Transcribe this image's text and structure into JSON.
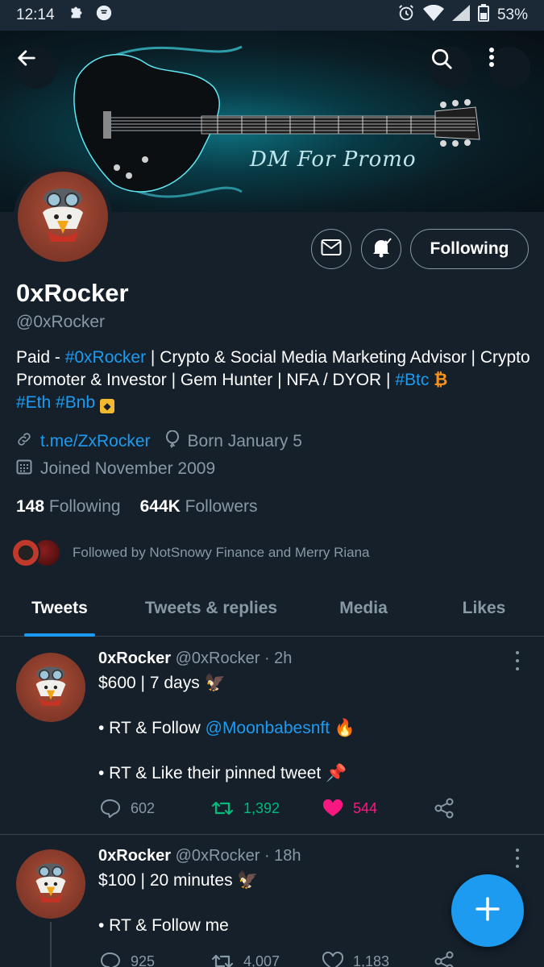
{
  "status_bar": {
    "time": "12:14",
    "battery": "53%",
    "icons": [
      "puzzle-icon",
      "chat-bubble-icon",
      "alarm-icon",
      "wifi-icon",
      "signal-icon",
      "battery-icon"
    ]
  },
  "header": {
    "banner_text": "DM For Promo",
    "back_icon": "arrow-left-icon",
    "search_icon": "search-icon",
    "more_icon": "more-vertical-icon"
  },
  "profile": {
    "name": "0xRocker",
    "handle": "@0xRocker",
    "bio": {
      "prefix": "Paid - ",
      "tag1": "#0xRocker",
      "text1": " | Crypto & Social Media Marketing Advisor | Crypto Promoter & Investor | Gem Hunter | NFA / DYOR | ",
      "tag2": "#Btc",
      "emoji1": "₿",
      "tag3": "#Eth",
      "tag4": "#Bnb",
      "emoji2": "◆"
    },
    "website": "t.me/ZxRocker",
    "birthday": "Born January 5",
    "joined": "Joined November 2009",
    "following_count": "148",
    "following_label": "Following",
    "followers_count": "644K",
    "followers_label": "Followers",
    "followed_by": "Followed by NotSnowy Finance and Merry Riana",
    "following_button": "Following"
  },
  "tabs": [
    {
      "label": "Tweets",
      "active": true
    },
    {
      "label": "Tweets & replies",
      "active": false
    },
    {
      "label": "Media",
      "active": false
    },
    {
      "label": "Likes",
      "active": false
    }
  ],
  "tweets": [
    {
      "name": "0xRocker",
      "handle": "@0xRocker",
      "time": "· 2h",
      "line1": "$600 | 7 days 🦅",
      "line2_prefix": "• RT & Follow ",
      "line2_mention": "@Moonbabesnft",
      "line2_suffix": " 🔥",
      "line3": "• RT & Like their pinned tweet 📌",
      "replies": "602",
      "retweets": "1,392",
      "likes": "544",
      "retweeted": true,
      "liked": true
    },
    {
      "name": "0xRocker",
      "handle": "@0xRocker",
      "time": "· 18h",
      "line1": "$100 | 20 minutes 🦅",
      "line2": "• RT & Follow me",
      "replies": "925",
      "retweets": "4,007",
      "likes": "1,183",
      "retweeted": false,
      "liked": false
    }
  ],
  "colors": {
    "background": "#15202b",
    "accent": "#1d9bf0",
    "retweet_green": "#00ba7c",
    "like_pink": "#f91880",
    "secondary_text": "#8899a6"
  }
}
